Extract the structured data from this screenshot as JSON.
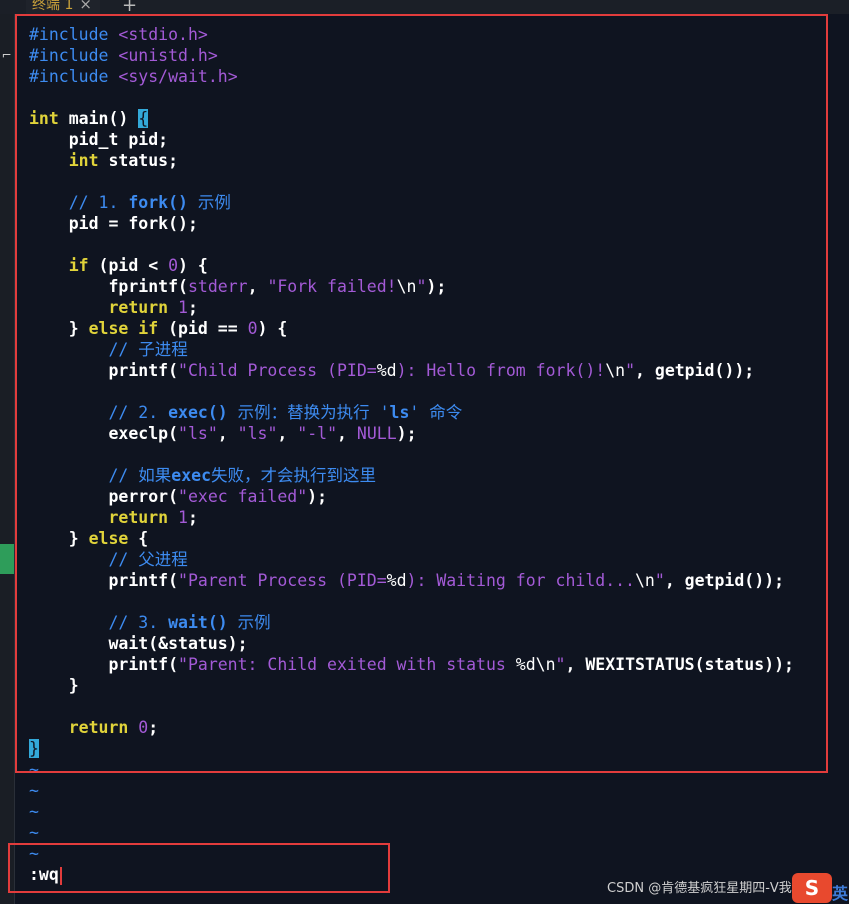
{
  "tab": {
    "label": "终端 1",
    "close_glyph": "×",
    "add_glyph": "+"
  },
  "sidebar": {
    "icon_glyph": "⌐"
  },
  "code": {
    "l1": [
      "#include",
      " ",
      "<stdio.h>"
    ],
    "l2": [
      "#include",
      " ",
      "<unistd.h>"
    ],
    "l3": [
      "#include",
      " ",
      "<sys/wait.h>"
    ],
    "l5": [
      "int",
      " main() ",
      "{"
    ],
    "l6": [
      "    pid_t pid;"
    ],
    "l7": [
      "    ",
      "int",
      " status;"
    ],
    "l9": [
      "    ",
      "// 1. ",
      "fork()",
      " 示例"
    ],
    "l10": [
      "    pid = fork();"
    ],
    "l12": [
      "    ",
      "if",
      " (pid < ",
      "0",
      ") {"
    ],
    "l13": [
      "        fprintf(",
      "stderr",
      ", ",
      "\"Fork failed!",
      "\\n",
      "\"",
      ");"
    ],
    "l14": [
      "        ",
      "return",
      " ",
      "1",
      ";"
    ],
    "l15": [
      "    } ",
      "else if",
      " (pid == ",
      "0",
      ") {"
    ],
    "l16": [
      "        ",
      "// 子进程"
    ],
    "l17": [
      "        printf(",
      "\"Child Process (PID=",
      "%d",
      "): Hello from fork()!",
      "\\n",
      "\"",
      ", getpid());"
    ],
    "l19": [
      "        ",
      "// 2. ",
      "exec()",
      " 示例：替换为执行 '",
      "ls",
      "' 命令"
    ],
    "l20": [
      "        execlp(",
      "\"ls\"",
      ", ",
      "\"ls\"",
      ", ",
      "\"-l\"",
      ", ",
      "NULL",
      ");"
    ],
    "l22": [
      "        ",
      "// 如果",
      "exec",
      "失败，才会执行到这里"
    ],
    "l23": [
      "        perror(",
      "\"exec failed\"",
      ");"
    ],
    "l24": [
      "        ",
      "return",
      " ",
      "1",
      ";"
    ],
    "l25": [
      "    } ",
      "else",
      " {"
    ],
    "l26": [
      "        ",
      "// 父进程"
    ],
    "l27": [
      "        printf(",
      "\"Parent Process (PID=",
      "%d",
      "): Waiting for child...",
      "\\n",
      "\"",
      ", getpid());"
    ],
    "l29": [
      "        ",
      "// 3. ",
      "wait()",
      " 示例"
    ],
    "l30": [
      "        wait(&status);"
    ],
    "l31": [
      "        printf(",
      "\"Parent: Child exited with status ",
      "%d",
      "\\n",
      "\"",
      ", ",
      "WEXITSTATUS",
      "(status));"
    ],
    "l32": [
      "    }"
    ],
    "l34": [
      "    ",
      "return",
      " ",
      "0",
      ";"
    ],
    "l35": [
      "}"
    ]
  },
  "tildes": [
    "~",
    "~",
    "~",
    "~",
    "~"
  ],
  "command": {
    "text": ":wq"
  },
  "watermark": {
    "text": "CSDN @肯德基疯狂星期四-V我50"
  },
  "logo": {
    "text": "S",
    "tail": "英"
  },
  "colors": {
    "highlight": "#e23c3c",
    "keyword": "#e0d33a",
    "string": "#a35ad6",
    "comment": "#3d8bf0",
    "brace_match": "#33a9d9"
  }
}
